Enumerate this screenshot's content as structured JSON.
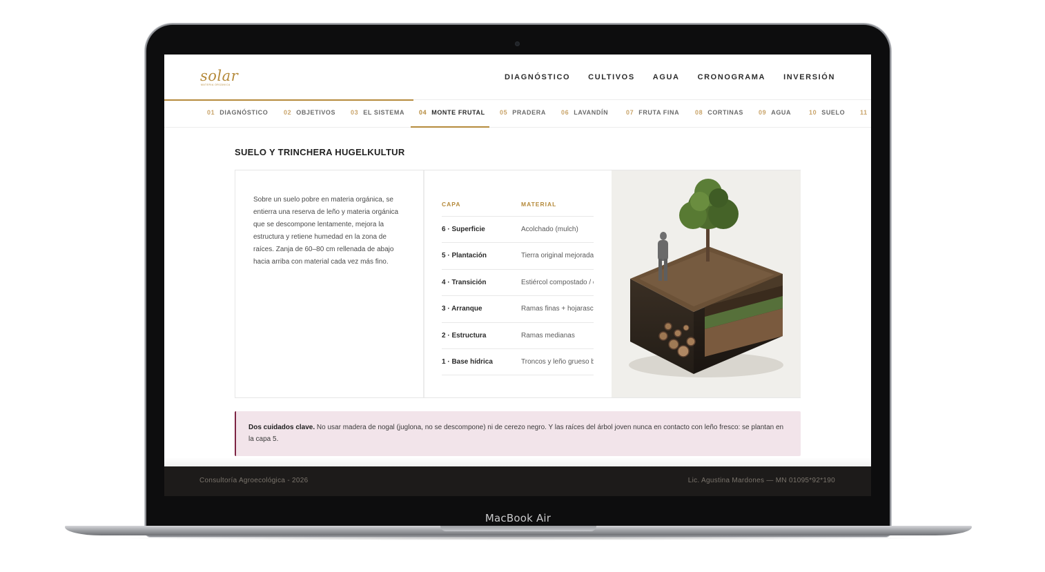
{
  "device": {
    "label": "MacBook Air"
  },
  "brand": {
    "logo_text": "solar",
    "logo_subtext": "MATERIA ORGÁNICA"
  },
  "main_nav": [
    "DIAGNÓSTICO",
    "CULTIVOS",
    "AGUA",
    "CRONOGRAMA",
    "INVERSIÓN"
  ],
  "sub_nav": [
    {
      "num": "01",
      "label": "DIAGNÓSTICO"
    },
    {
      "num": "02",
      "label": "OBJETIVOS"
    },
    {
      "num": "03",
      "label": "EL SISTEMA"
    },
    {
      "num": "04",
      "label": "MONTE FRUTAL"
    },
    {
      "num": "05",
      "label": "PRADERA"
    },
    {
      "num": "06",
      "label": "LAVANDÍN"
    },
    {
      "num": "07",
      "label": "FRUTA FINA"
    },
    {
      "num": "08",
      "label": "CORTINAS"
    },
    {
      "num": "09",
      "label": "AGUA"
    },
    {
      "num": "10",
      "label": "SUELO"
    },
    {
      "num": "11",
      "label": ""
    }
  ],
  "active_sub_nav": "04",
  "section": {
    "title": "SUELO Y TRINCHERA HUGELKULTUR",
    "intro": "Sobre un suelo pobre en materia orgánica, se entierra una reserva de leño y materia orgánica que se descompone lentamente, mejora la estructura y retiene humedad en la zona de raíces. Zanja de 60–80 cm rellenada de abajo hacia arriba con material cada vez más fino.",
    "table": {
      "headers": {
        "capa": "CAPA",
        "material": "MATERIAL"
      },
      "rows": [
        {
          "capa": "6 · Superficie",
          "material": "Acolchado (mulch)"
        },
        {
          "capa": "5 · Plantación",
          "material": "Tierra original mejorada"
        },
        {
          "capa": "4 · Transición",
          "material": "Estiércol compostado / c"
        },
        {
          "capa": "3 · Arranque",
          "material": "Ramas finas + hojarasca"
        },
        {
          "capa": "2 · Estructura",
          "material": "Ramas medianas"
        },
        {
          "capa": "1 · Base hídrica",
          "material": "Troncos y leño grueso b"
        }
      ]
    },
    "note": {
      "bold": "Dos cuidados clave.",
      "text": " No usar madera de nogal (juglona, no se descompone) ni de cerezo negro. Y las raíces del árbol joven nunca en contacto con leño fresco: se plantan en la capa 5."
    }
  },
  "footer": {
    "left": "Consultoría Agroecológica - 2026",
    "right": "Lic. Agustina Mardones — MN 01095*92*190"
  }
}
